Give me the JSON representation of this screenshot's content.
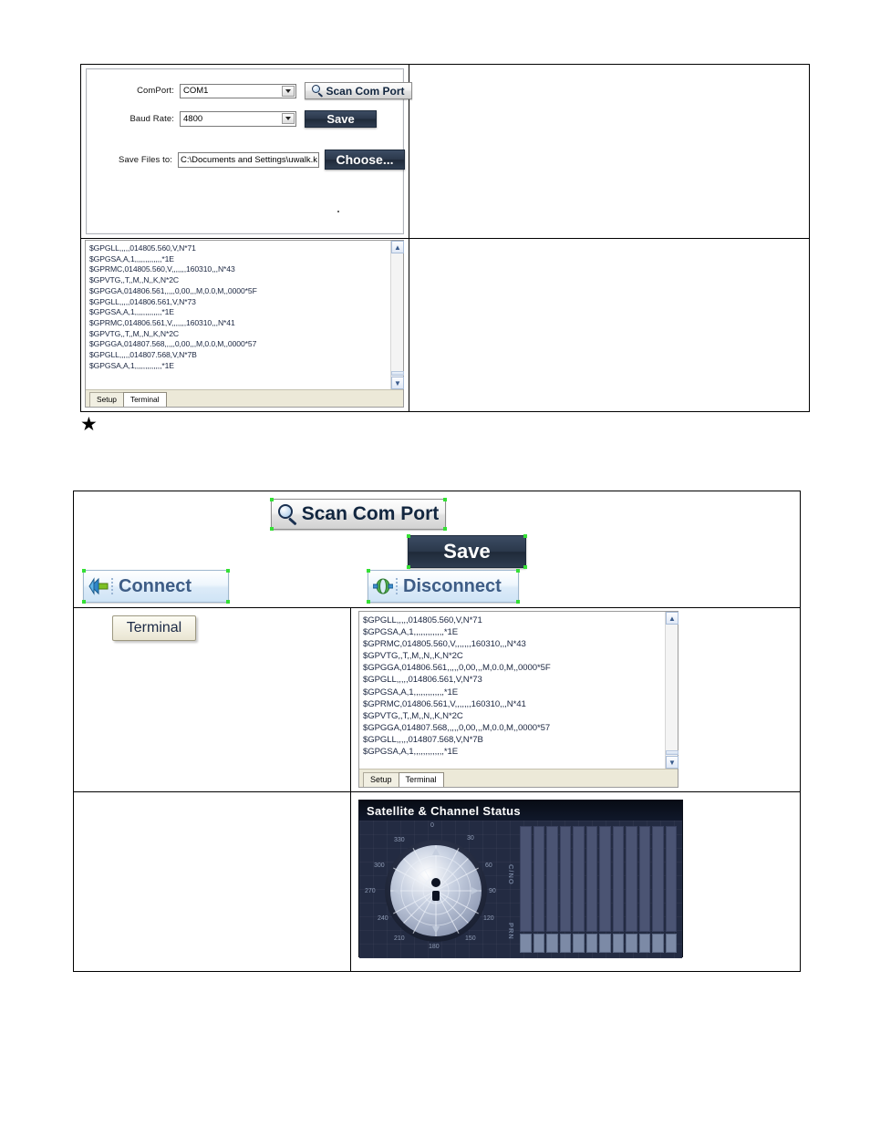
{
  "setup_form": {
    "comport_label": "ComPort:",
    "comport_value": "COM1",
    "baudrate_label": "Baud Rate:",
    "baudrate_value": "4800",
    "savefiles_label": "Save Files to:",
    "savefiles_value": "C:\\Documents and Settings\\uwalk.k",
    "scan_button": "Scan Com Port",
    "save_button": "Save",
    "choose_button": "Choose..."
  },
  "terminal": {
    "lines": [
      "$GPGLL,,,,,014805.560,V,N*71",
      "$GPGSA,A,1,,,,,,,,,,,,,*1E",
      "$GPRMC,014805.560,V,,,,,,,160310,,,N*43",
      "$GPVTG,,T,,M,,N,,K,N*2C",
      "$GPGGA,014806.561,,,,,0,00,,,M,0.0,M,,0000*5F",
      "$GPGLL,,,,,014806.561,V,N*73",
      "$GPGSA,A,1,,,,,,,,,,,,,*1E",
      "$GPRMC,014806.561,V,,,,,,,160310,,,N*41",
      "$GPVTG,,T,,M,,N,,K,N*2C",
      "$GPGGA,014807.568,,,,,0,00,,,M,0.0,M,,0000*57",
      "$GPGLL,,,,,014807.568,V,N*7B",
      "$GPGSA,A,1,,,,,,,,,,,,,*1E"
    ],
    "tab_setup": "Setup",
    "tab_terminal": "Terminal",
    "scroll_up_icon": "chevron-up-icon",
    "scroll_down_icon": "chevron-down-icon"
  },
  "marker": {
    "star": "★"
  },
  "callouts": {
    "scan_com_port": "Scan Com Port",
    "save": "Save",
    "connect": "Connect",
    "disconnect": "Disconnect",
    "terminal": "Terminal"
  },
  "satellite": {
    "title": "Satellite & Channel Status",
    "azimuth_ticks": [
      "0",
      "30",
      "60",
      "90",
      "120",
      "150",
      "180",
      "210",
      "240",
      "270",
      "300",
      "330"
    ],
    "cno_label": "C/NO",
    "prn_label": "PRN",
    "channel_count": 12
  },
  "colors": {
    "accent_dark_button": "#2b384b",
    "glass_button_text": "#3e5d86",
    "terminal_text": "#1b2640",
    "sat_panel_bg": "#232b42",
    "sat_title_bg": "#0a0f1a",
    "selection_handle": "#35e035"
  }
}
